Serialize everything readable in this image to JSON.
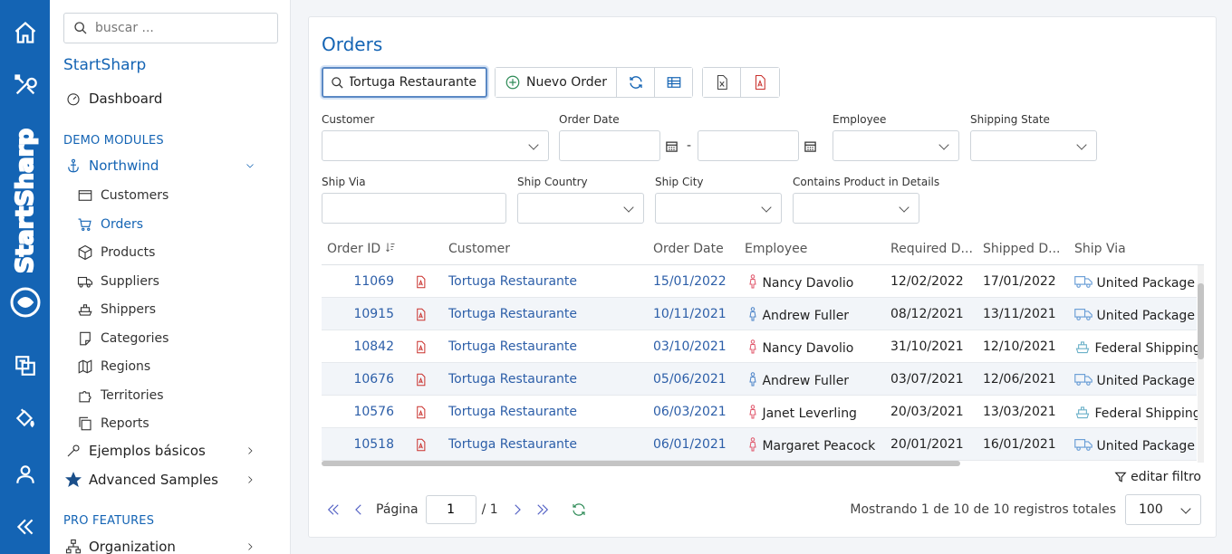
{
  "rail": {
    "brand": "StartSharp"
  },
  "sidebar": {
    "search_placeholder": "buscar ...",
    "brand": "StartSharp",
    "dashboard": "Dashboard",
    "section_demo": "DEMO MODULES",
    "northwind": "Northwind",
    "items": [
      {
        "label": "Customers",
        "icon": "card-icon",
        "active": false
      },
      {
        "label": "Orders",
        "icon": "cart-icon",
        "active": true
      },
      {
        "label": "Products",
        "icon": "cube-icon",
        "active": false
      },
      {
        "label": "Suppliers",
        "icon": "truck-icon",
        "active": false
      },
      {
        "label": "Shippers",
        "icon": "ship-icon",
        "active": false
      },
      {
        "label": "Categories",
        "icon": "note-icon",
        "active": false
      },
      {
        "label": "Regions",
        "icon": "map-icon",
        "active": false
      },
      {
        "label": "Territories",
        "icon": "puzzle-icon",
        "active": false
      },
      {
        "label": "Reports",
        "icon": "copy-icon",
        "active": false
      }
    ],
    "basic_samples": "Ejemplos básicos",
    "advanced_samples": "Advanced Samples",
    "section_pro": "PRO FEATURES",
    "organization": "Organization"
  },
  "main": {
    "title": "Orders",
    "quick_search": "Tortuga Restaurante",
    "new_button": "Nuevo Order",
    "filters": {
      "customer": "Customer",
      "order_date": "Order Date",
      "date_sep": "-",
      "employee": "Employee",
      "shipping_state": "Shipping State",
      "ship_via": "Ship Via",
      "ship_country": "Ship Country",
      "ship_city": "Ship City",
      "contains_product": "Contains Product in Details"
    },
    "columns": [
      "Order ID",
      "Customer",
      "Order Date",
      "Employee",
      "Required D...",
      "Shipped D...",
      "Ship Via"
    ],
    "rows": [
      {
        "id": "11069",
        "customer": "Tortuga Restaurante",
        "order_date": "15/01/2022",
        "employee": "Nancy Davolio",
        "gender": "f",
        "required": "12/02/2022",
        "shipped": "17/01/2022",
        "ship_via": "United Package",
        "via_icon": "truck"
      },
      {
        "id": "10915",
        "customer": "Tortuga Restaurante",
        "order_date": "10/11/2021",
        "employee": "Andrew Fuller",
        "gender": "m",
        "required": "08/12/2021",
        "shipped": "13/11/2021",
        "ship_via": "United Package",
        "via_icon": "truck"
      },
      {
        "id": "10842",
        "customer": "Tortuga Restaurante",
        "order_date": "03/10/2021",
        "employee": "Nancy Davolio",
        "gender": "f",
        "required": "31/10/2021",
        "shipped": "12/10/2021",
        "ship_via": "Federal Shipping",
        "via_icon": "ship"
      },
      {
        "id": "10676",
        "customer": "Tortuga Restaurante",
        "order_date": "05/06/2021",
        "employee": "Andrew Fuller",
        "gender": "m",
        "required": "03/07/2021",
        "shipped": "12/06/2021",
        "ship_via": "United Package",
        "via_icon": "truck"
      },
      {
        "id": "10576",
        "customer": "Tortuga Restaurante",
        "order_date": "06/03/2021",
        "employee": "Janet Leverling",
        "gender": "f",
        "required": "20/03/2021",
        "shipped": "13/03/2021",
        "ship_via": "Federal Shipping",
        "via_icon": "ship"
      },
      {
        "id": "10518",
        "customer": "Tortuga Restaurante",
        "order_date": "06/01/2021",
        "employee": "Margaret Peacock",
        "gender": "f",
        "required": "20/01/2021",
        "shipped": "16/01/2021",
        "ship_via": "United Package",
        "via_icon": "truck"
      }
    ],
    "edit_filter": "editar filtro",
    "pager": {
      "page_label": "Página",
      "page": "1",
      "of": "/ 1",
      "status": "Mostrando 1 de 10 de 10 registros totales",
      "page_size": "100"
    }
  },
  "colors": {
    "brand": "#1464b4",
    "link": "#2c5ea8",
    "pdf": "#c9302c",
    "female": "#e0556a",
    "male": "#4a82c8"
  }
}
